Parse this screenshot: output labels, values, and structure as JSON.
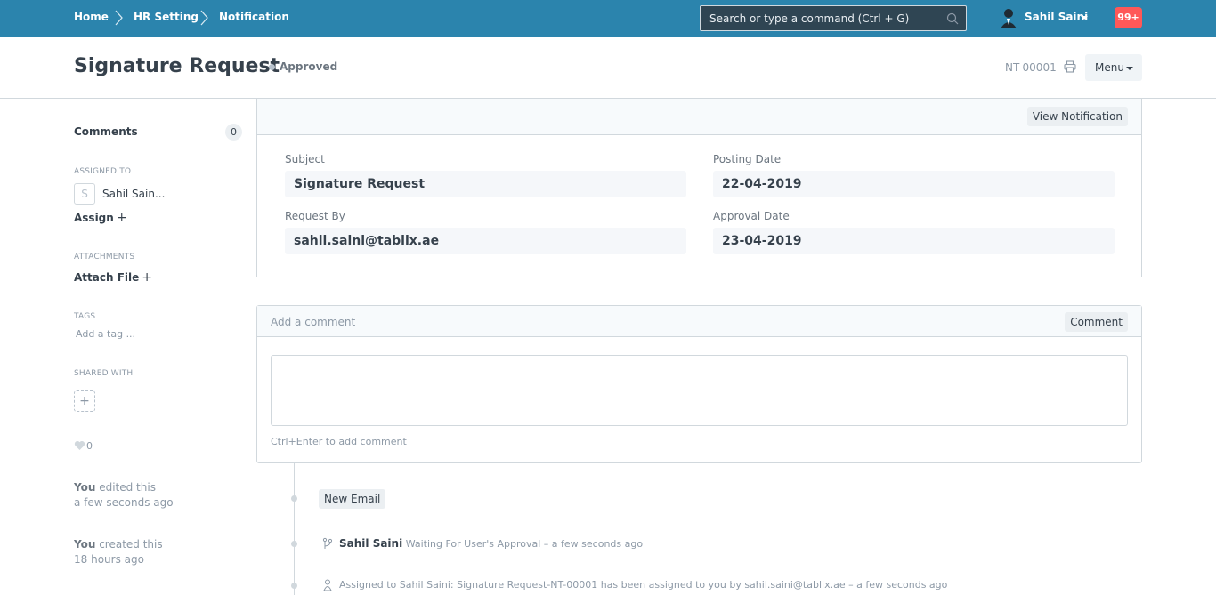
{
  "navbar": {
    "breadcrumbs": [
      "Home",
      "HR Setting",
      "Notification"
    ],
    "search_placeholder": "Search or type a command (Ctrl + G)",
    "user_name": "Sahil Saini",
    "notification_count": "99+"
  },
  "page": {
    "title": "Signature Request",
    "status": "Approved",
    "doc_id": "NT-00001",
    "menu_label": "Menu"
  },
  "sidebar": {
    "comments_label": "Comments",
    "comments_count": "0",
    "assigned_to_label": "ASSIGNED TO",
    "assignee_initial": "S",
    "assignee_name": "Sahil Sain...",
    "assign_label": "Assign",
    "attachments_label": "ATTACHMENTS",
    "attach_file_label": "Attach File",
    "tags_label": "TAGS",
    "tag_placeholder": "Add a tag ...",
    "shared_with_label": "SHARED WITH",
    "share_add": "+",
    "like_count": "0",
    "activity": [
      {
        "who": "You",
        "action": "edited this",
        "when": "a few seconds ago"
      },
      {
        "who": "You",
        "action": "created this",
        "when": "18 hours ago"
      }
    ]
  },
  "form": {
    "view_notification_label": "View Notification",
    "fields": {
      "subject_label": "Subject",
      "subject_value": "Signature Request",
      "posting_date_label": "Posting Date",
      "posting_date_value": "22-04-2019",
      "request_by_label": "Request By",
      "request_by_value": "sahil.saini@tablix.ae",
      "approval_date_label": "Approval Date",
      "approval_date_value": "23-04-2019"
    }
  },
  "comment": {
    "placeholder": "Add a comment",
    "button": "Comment",
    "hint": "Ctrl+Enter to add comment"
  },
  "timeline": {
    "new_email_label": "New Email",
    "items": [
      {
        "user": "Sahil Saini",
        "text": "Waiting For User's Approval – a few seconds ago"
      },
      {
        "text": "Assigned to Sahil Saini: Signature Request-NT-00001 has been assigned to you by sahil.saini@tablix.ae – a few seconds ago"
      }
    ]
  },
  "colors": {
    "navbar": "#2b84ad",
    "notification_badge": "#ff5858"
  }
}
